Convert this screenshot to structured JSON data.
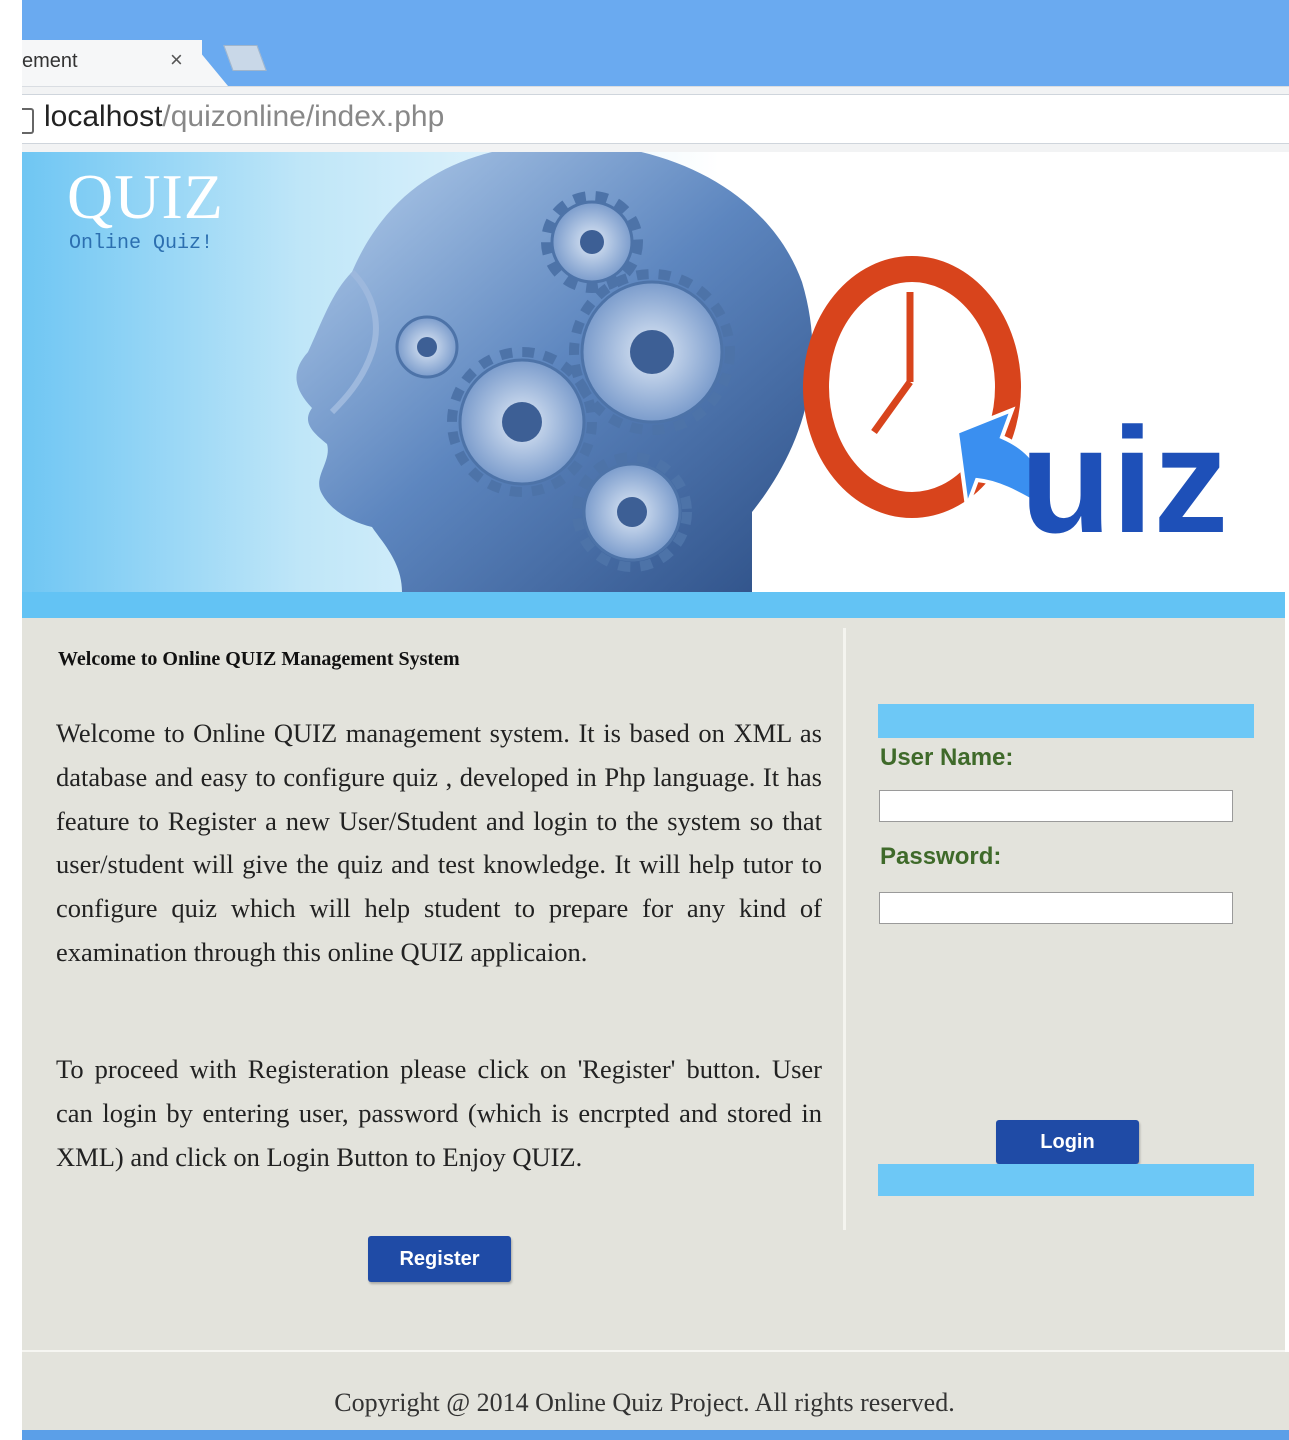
{
  "browser": {
    "tab_title": "ement",
    "tab_close": "×",
    "url_host": "localhost",
    "url_path": "/quizonline/index.php"
  },
  "banner": {
    "brand_title": "QUIZ",
    "brand_subtitle": "Online Quiz!",
    "logo_text": "uiz"
  },
  "main": {
    "heading": "Welcome to Online QUIZ Management System",
    "paragraph1": "Welcome to Online QUIZ management system. It is based on XML as database and easy to configure quiz , developed in Php language. It has feature to Register a new User/Student and login to the system so that user/student will give the quiz and test knowledge. It will help tutor to configure quiz which will help student to prepare for any kind of examination through this online QUIZ applicaion.",
    "paragraph2": "To proceed with Registeration please click on 'Register' button. User can login by entering user, password (which is encrpted and stored in XML) and click on Login Button to Enjoy QUIZ.",
    "register_label": "Register"
  },
  "login": {
    "username_label": "User Name:",
    "username_value": "",
    "password_label": "Password:",
    "password_value": "",
    "login_label": "Login"
  },
  "footer": {
    "copyright": "Copyright @ 2014 Online Quiz Project. All rights reserved."
  },
  "colors": {
    "accent_stripe": "#63c3f4",
    "button": "#1f4ba6",
    "label_green": "#3f6a2a",
    "logo_red": "#d8441c",
    "logo_blue": "#1e50b8"
  }
}
